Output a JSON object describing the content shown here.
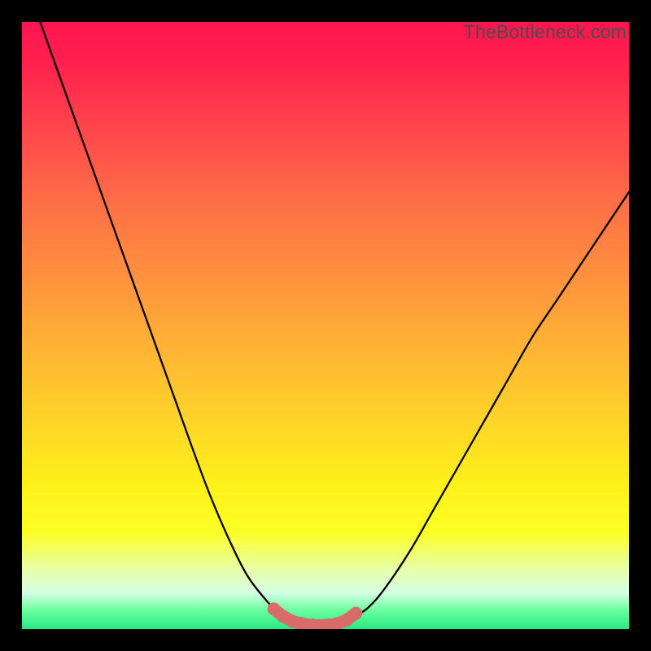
{
  "watermark": "TheBottleneck.com",
  "colors": {
    "frame": "#000000",
    "curve_stroke": "#000000",
    "marker_fill": "#d96b6b",
    "marker_stroke": "#d96b6b"
  },
  "chart_data": {
    "type": "line",
    "title": "",
    "xlabel": "",
    "ylabel": "",
    "xlim": [
      0,
      100
    ],
    "ylim": [
      0,
      100
    ],
    "series": [
      {
        "name": "bottleneck-curve",
        "x": [
          3,
          8,
          13,
          18,
          23,
          28,
          31,
          34,
          37,
          40,
          42,
          44,
          46,
          48,
          50,
          52,
          54,
          57,
          60,
          64,
          68,
          72,
          76,
          80,
          84,
          88,
          92,
          96,
          100
        ],
        "y": [
          100,
          86,
          72,
          58,
          44,
          30,
          22,
          15,
          9,
          5,
          3,
          1.8,
          1,
          0.6,
          0.6,
          0.8,
          1.6,
          3.5,
          7,
          13,
          20,
          27,
          34,
          41,
          48,
          54,
          60,
          66,
          72
        ]
      }
    ],
    "markers": {
      "name": "valley-markers",
      "x": [
        41.5,
        43,
        44.5,
        46,
        48,
        50,
        52,
        53.5,
        55
      ],
      "y": [
        3.3,
        2.1,
        1.3,
        0.9,
        0.6,
        0.6,
        0.9,
        1.5,
        2.6
      ]
    },
    "gradient_stops": [
      {
        "pos": 0,
        "color": "#ff1550"
      },
      {
        "pos": 18,
        "color": "#ff474b"
      },
      {
        "pos": 42,
        "color": "#ff913e"
      },
      {
        "pos": 66,
        "color": "#ffd528"
      },
      {
        "pos": 84,
        "color": "#fbff24"
      },
      {
        "pos": 97,
        "color": "#69ff9d"
      },
      {
        "pos": 100,
        "color": "#25e884"
      }
    ]
  }
}
